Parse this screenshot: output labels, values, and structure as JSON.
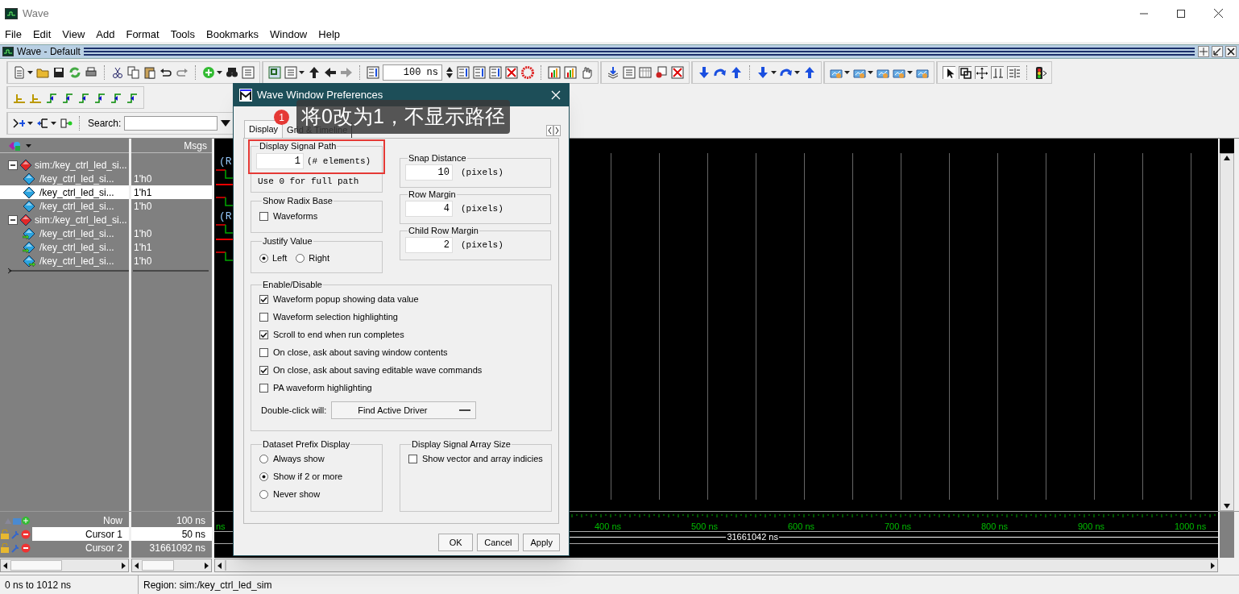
{
  "window": {
    "title": "Wave"
  },
  "menu": [
    "File",
    "Edit",
    "View",
    "Add",
    "Format",
    "Tools",
    "Bookmarks",
    "Window",
    "Help"
  ],
  "subwindow": {
    "title": "Wave - Default"
  },
  "toolbar": {
    "time_value": "100 ns",
    "search_label": "Search:"
  },
  "signal_pane": {
    "header": "Msgs",
    "groups": [
      {
        "name": "sim:/key_ctrl_led_si...",
        "wave_text": "(R",
        "expanded": true,
        "children": [
          {
            "name": "/key_ctrl_led_si...",
            "value": "1'h0",
            "kind": "plain",
            "selected": false,
            "wave_high": false
          },
          {
            "name": "/key_ctrl_led_si...",
            "value": "1'h1",
            "kind": "plain",
            "selected": true,
            "wave_high": true
          },
          {
            "name": "/key_ctrl_led_si...",
            "value": "1'h0",
            "kind": "plain",
            "selected": false,
            "wave_high": false
          }
        ]
      },
      {
        "name": "sim:/key_ctrl_led_si...",
        "wave_text": "(R",
        "expanded": true,
        "children": [
          {
            "name": "/key_ctrl_led_si...",
            "value": "1'h0",
            "kind": "input",
            "selected": false,
            "wave_high": false
          },
          {
            "name": "/key_ctrl_led_si...",
            "value": "1'h1",
            "kind": "input",
            "selected": false,
            "wave_high": true
          },
          {
            "name": "/key_ctrl_led_si...",
            "value": "1'h0",
            "kind": "output",
            "selected": false,
            "wave_high": false
          }
        ]
      }
    ]
  },
  "cursors": [
    {
      "label": "Now",
      "value": "100 ns",
      "selected": false,
      "kind": "now"
    },
    {
      "label": "Cursor 1",
      "value": "50 ns",
      "selected": true,
      "kind": "cursor"
    },
    {
      "label": "Cursor 2",
      "value": "31661092 ns",
      "selected": false,
      "kind": "cursor"
    }
  ],
  "timeline": {
    "ticks": [
      "ns",
      "400 ns",
      "500 ns",
      "600 ns",
      "700 ns",
      "800 ns",
      "900 ns",
      "1000 ns"
    ],
    "cursor_readout": "31661042 ns"
  },
  "status_bar": [
    "0 ns to 1012 ns",
    "Region: sim:/key_ctrl_led_sim"
  ],
  "dialog": {
    "title": "Wave Window Preferences",
    "tabs": [
      {
        "label": "Display",
        "selected": true
      },
      {
        "label": "Grid & Timeline",
        "selected": false
      }
    ],
    "signal_path": {
      "legend": "Display Signal Path",
      "value": "1",
      "suffix": "(# elements)",
      "hint": "Use 0 for full path"
    },
    "radix": {
      "legend": "Show Radix Base",
      "label": "Waveforms",
      "checked": false
    },
    "justify": {
      "legend": "Justify Value",
      "options": [
        {
          "label": "Left",
          "selected": true
        },
        {
          "label": "Right",
          "selected": false
        }
      ]
    },
    "spacing": [
      {
        "legend": "Snap Distance",
        "value": "10",
        "unit": "(pixels)"
      },
      {
        "legend": "Row Margin",
        "value": "4",
        "unit": "(pixels)"
      },
      {
        "legend": "Child Row Margin",
        "value": "2",
        "unit": "(pixels)"
      }
    ],
    "enable": {
      "legend": "Enable/Disable",
      "options": [
        {
          "label": "Waveform popup showing data value",
          "checked": true
        },
        {
          "label": "Waveform selection highlighting",
          "checked": false
        },
        {
          "label": "Scroll to end when run completes",
          "checked": true
        },
        {
          "label": "On close, ask about saving window contents",
          "checked": false
        },
        {
          "label": "On close, ask about saving editable wave commands",
          "checked": true
        },
        {
          "label": "PA waveform highlighting",
          "checked": false
        }
      ],
      "double_click_label": "Double-click will:",
      "double_click_value": "Find Active Driver"
    },
    "dataset": {
      "legend": "Dataset Prefix Display",
      "options": [
        {
          "label": "Always show",
          "selected": false
        },
        {
          "label": "Show if 2 or more",
          "selected": true
        },
        {
          "label": "Never show",
          "selected": false
        }
      ]
    },
    "array_size": {
      "legend": "Display Signal Array Size",
      "label": "Show vector and array indicies",
      "checked": false
    },
    "buttons": [
      "OK",
      "Cancel",
      "Apply"
    ]
  },
  "annotation": {
    "badge": "1",
    "text": "将0改为1，不显示路径"
  }
}
